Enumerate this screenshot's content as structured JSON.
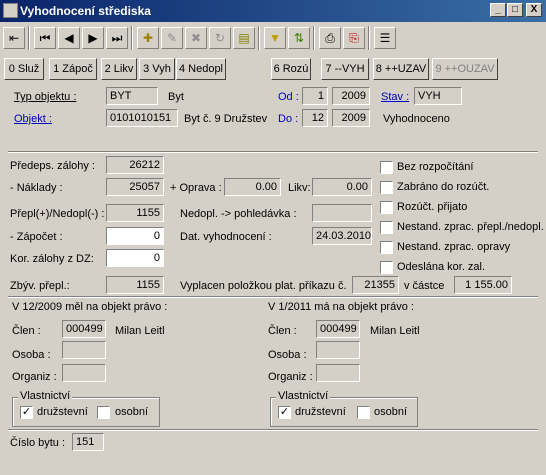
{
  "window": {
    "title": "Vyhodnocení střediska",
    "min": "_",
    "max": "□",
    "close": "X"
  },
  "fkeys": [
    {
      "label": "0 Služ"
    },
    {
      "label": "1 Zápoč"
    },
    {
      "label": "2 Likv"
    },
    {
      "label": "3 Vyh"
    },
    {
      "label": "4 Nedopl"
    },
    {
      "label": "6 Rozú"
    },
    {
      "label": "7 --VYH"
    },
    {
      "label": "8 ++UZAV"
    },
    {
      "label": "9 ++OUZAV"
    }
  ],
  "header": {
    "typ_label": "Typ objektu :",
    "typ_code": "BYT",
    "typ_name": "Byt",
    "objekt_label": "Objekt :",
    "objekt_code": "0101010151",
    "objekt_name": "Byt č.  9 Družstev",
    "od_label": "Od :",
    "od_month": "1",
    "od_year": "2009",
    "do_label": "Do :",
    "do_month": "12",
    "do_year": "2009",
    "stav_label": "Stav :",
    "stav_code": "VYH",
    "stav_name": "Vyhodnoceno"
  },
  "amounts": {
    "predeps_label": "Předeps. zálohy :",
    "predeps": "26212",
    "naklady_label": "- Náklady :",
    "naklady": "25057",
    "oprava_label": "+ Oprava :",
    "oprava": "0.00",
    "likv_label": "Likv:",
    "likv": "0.00",
    "prepl_label": "Přepl(+)/Nedopl(-) :",
    "prepl": "1155",
    "nedopl_label": "Nedopl. -> pohledávka :",
    "nedopl": "",
    "zapocet_label": "- Zápočet :",
    "zapocet": "0",
    "dat_label": "Dat. vyhodnocení :",
    "dat": "24.03.2010",
    "kor_label": "Kor. zálohy z DZ:",
    "kor": "0",
    "zbyv_label": "Zbýv. přepl.:",
    "zbyv": "1155",
    "vyplacen_label": "Vyplacen položkou plat. příkazu č.",
    "prikaz": "21355",
    "castka_label": "v částce",
    "castka": "1 155.00"
  },
  "checks": [
    {
      "label": "Bez rozpočítání",
      "checked": false
    },
    {
      "label": "Zabráno do rozúčt.",
      "checked": false
    },
    {
      "label": "Rozúčt. přijato",
      "checked": false
    },
    {
      "label": "Nestand. zprac. přepl./nedopl.",
      "checked": false
    },
    {
      "label": "Nestand. zprac. opravy",
      "checked": false
    },
    {
      "label": "Odeslána kor. zal.",
      "checked": false
    }
  ],
  "left": {
    "heading": "V  12/2009 měl na objekt právo :",
    "clen_label": "Člen :",
    "clen_code": "000499",
    "clen_name": "Milan Leitl",
    "osoba_label": "Osoba :",
    "organiz_label": "Organiz :",
    "group": "Vlastnictví",
    "opt1": "družstevní",
    "opt2": "osobní",
    "opt1_checked": "✓",
    "opt2_checked": ""
  },
  "right": {
    "heading": "V  1/2011    má na objekt právo :",
    "clen_label": "Člen :",
    "clen_code": "000499",
    "clen_name": "Milan Leitl",
    "osoba_label": "Osoba :",
    "organiz_label": "Organiz :",
    "group": "Vlastnictví",
    "opt1": "družstevní",
    "opt2": "osobní",
    "opt1_checked": "✓",
    "opt2_checked": ""
  },
  "footer": {
    "cislo_label": "Číslo bytu :",
    "cislo": "151"
  }
}
